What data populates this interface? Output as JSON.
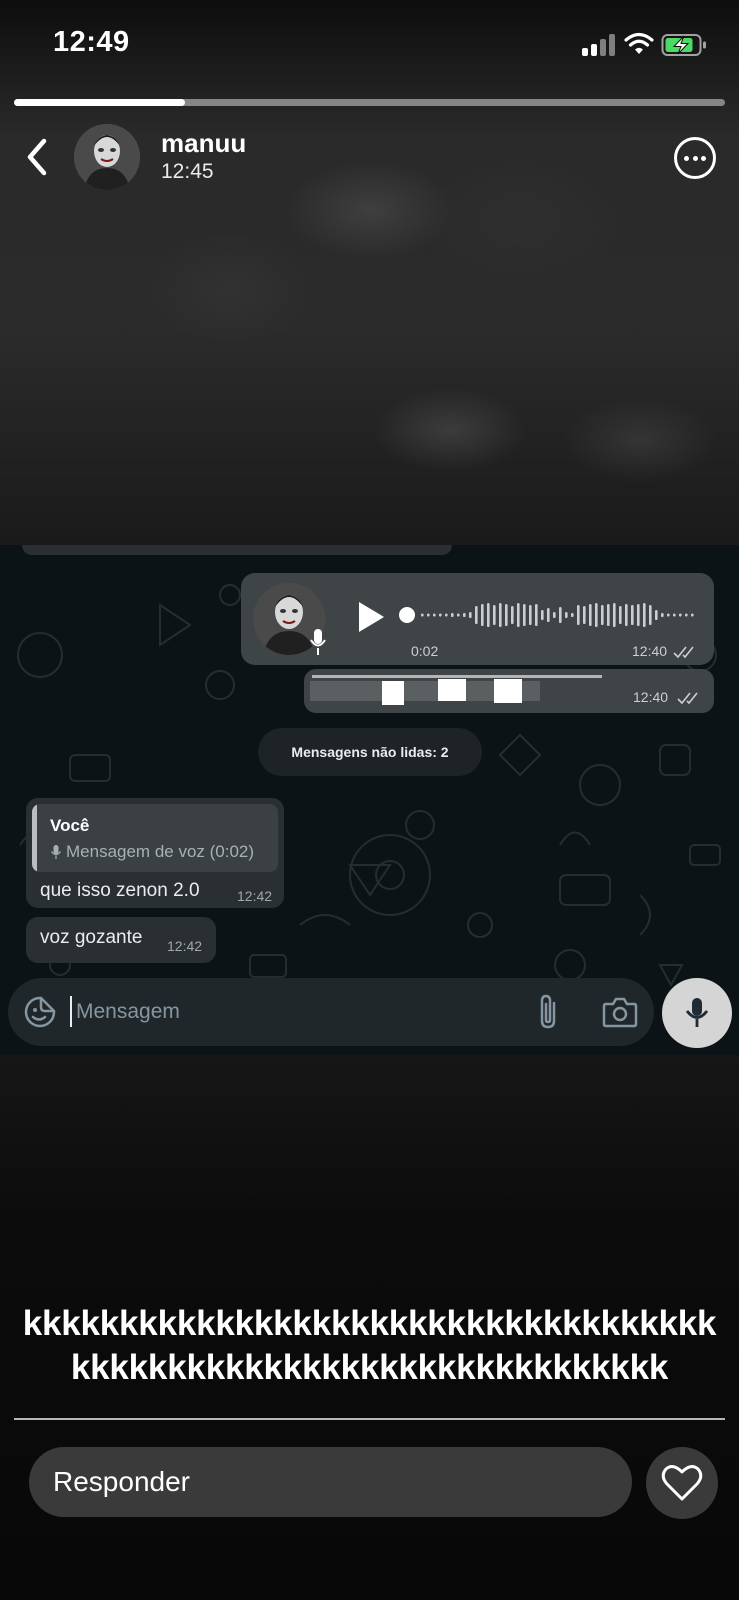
{
  "status_bar": {
    "time": "12:49",
    "battery_state": "charging"
  },
  "story": {
    "progress": 0.24,
    "user": "manuu",
    "time": "12:45"
  },
  "chat": {
    "voice_message": {
      "duration": "0:02",
      "time": "12:40"
    },
    "censored_message": {
      "time": "12:40"
    },
    "unread_label": "Mensagens não lidas: 2",
    "incoming": [
      {
        "quote_author": "Você",
        "quote_text": "Mensagem de voz (0:02)",
        "text": "que isso zenon 2.0",
        "time": "12:42"
      },
      {
        "text": "voz gozante",
        "time": "12:42"
      }
    ],
    "input_placeholder": "Mensagem"
  },
  "caption": "kkkkkkkkkkkkkkkkkkkkkkkkkkkkkkkkkkkkkkkkkkkkkkkkkkkkkkkkkkkkkkkkkkk",
  "reply": {
    "placeholder": "Responder"
  },
  "icons": {
    "back": "chevron-left-icon",
    "more": "more-circle-icon",
    "play": "play-icon",
    "mic": "mic-icon",
    "sticker": "sticker-icon",
    "attach": "paperclip-icon",
    "camera": "camera-icon",
    "heart": "heart-icon"
  },
  "colors": {
    "bubble_out": "#3f4447",
    "bubble_in": "#2a2f32",
    "chat_bg": "#0c1317",
    "battery_green": "#4cd964"
  }
}
